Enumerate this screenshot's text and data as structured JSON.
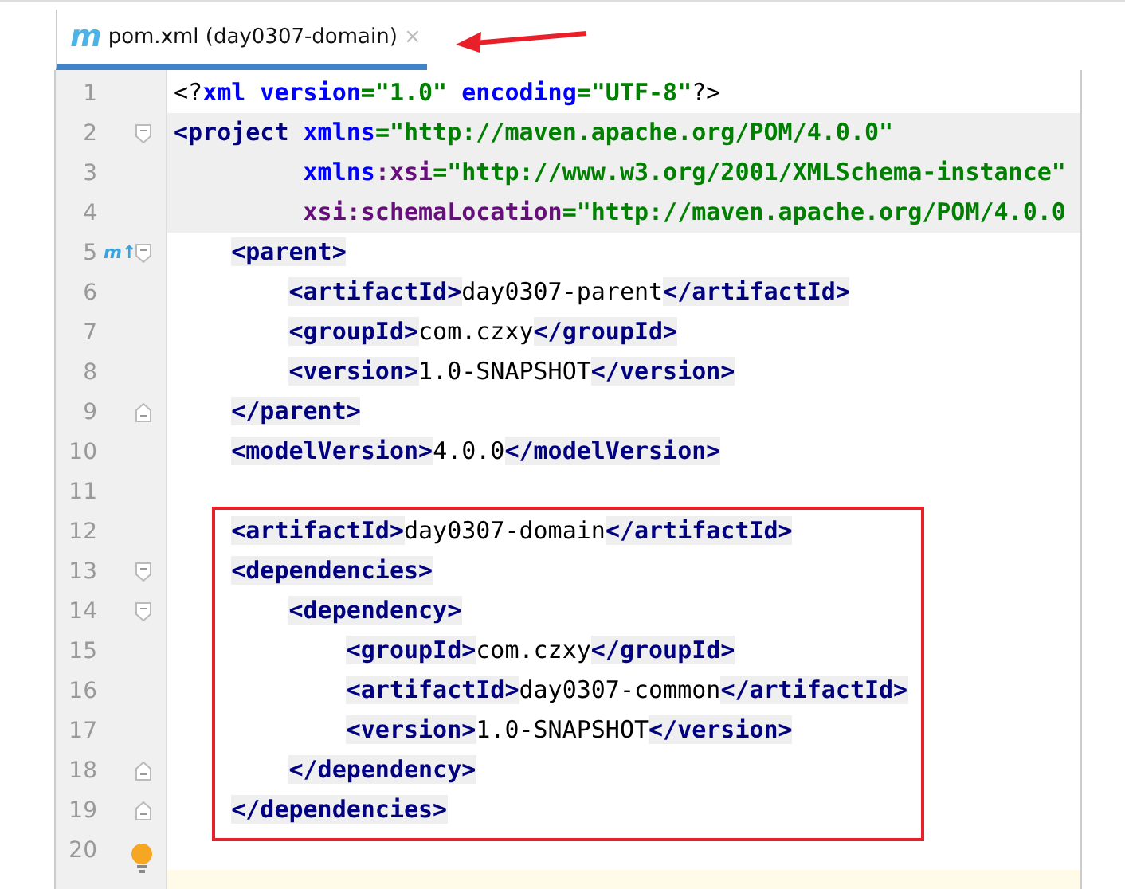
{
  "tab": {
    "icon_letter": "m",
    "title": "pom.xml (day0307-domain)",
    "close": "×",
    "selected": true
  },
  "lines": [
    {
      "number": "1",
      "tokens": [
        {
          "kind": "punct",
          "text": "<?"
        },
        {
          "kind": "attr",
          "text": "xml version"
        },
        {
          "kind": "value",
          "text": "=\"1.0\""
        },
        {
          "kind": "attr",
          "text": " encoding"
        },
        {
          "kind": "value",
          "text": "=\"UTF-8\""
        },
        {
          "kind": "punct",
          "text": "?>"
        }
      ]
    },
    {
      "number": "2",
      "highlighted": true,
      "fold_open": true,
      "tokens": [
        {
          "kind": "tag",
          "text": "<project"
        },
        {
          "kind": "attr",
          "text": " xmlns"
        },
        {
          "kind": "value",
          "text": "=\"http://maven.apache.org/POM/4.0.0\""
        }
      ]
    },
    {
      "number": "3",
      "highlighted": true,
      "tokens": [
        {
          "kind": "attr",
          "text": "         xmlns"
        },
        {
          "kind": "ns",
          "text": ":xsi"
        },
        {
          "kind": "value",
          "text": "=\"http://www.w3.org/2001/XMLSchema-instance\""
        }
      ]
    },
    {
      "number": "4",
      "highlighted": true,
      "tokens": [
        {
          "kind": "ns",
          "text": "         xsi:schemaLocation"
        },
        {
          "kind": "value",
          "text": "=\"http://maven.apache.org/POM/4.0.0"
        }
      ]
    },
    {
      "number": "5",
      "fold_open": true,
      "marker": "m↑",
      "tokens": [
        {
          "kind": "tag",
          "text": "    <parent>"
        }
      ]
    },
    {
      "number": "6",
      "tokens": [
        {
          "kind": "tag",
          "text": "        <artifactId>"
        },
        {
          "kind": "text",
          "text": "day0307-parent"
        },
        {
          "kind": "tag",
          "text": "</artifactId>"
        }
      ]
    },
    {
      "number": "7",
      "tokens": [
        {
          "kind": "tag",
          "text": "        <groupId>"
        },
        {
          "kind": "text",
          "text": "com.czxy"
        },
        {
          "kind": "tag",
          "text": "</groupId>"
        }
      ]
    },
    {
      "number": "8",
      "tokens": [
        {
          "kind": "tag",
          "text": "        <version>"
        },
        {
          "kind": "text",
          "text": "1.0-SNAPSHOT"
        },
        {
          "kind": "tag",
          "text": "</version>"
        }
      ]
    },
    {
      "number": "9",
      "fold_close": true,
      "tokens": [
        {
          "kind": "tag",
          "text": "    </parent>"
        }
      ]
    },
    {
      "number": "10",
      "tokens": [
        {
          "kind": "tag",
          "text": "    <modelVersion>"
        },
        {
          "kind": "text",
          "text": "4.0.0"
        },
        {
          "kind": "tag",
          "text": "</modelVersion>"
        }
      ]
    },
    {
      "number": "11"
    },
    {
      "number": "12",
      "tokens": [
        {
          "kind": "tag",
          "text": "    <artifactId>"
        },
        {
          "kind": "text",
          "text": "day0307-domain"
        },
        {
          "kind": "tag",
          "text": "</artifactId>"
        }
      ]
    },
    {
      "number": "13",
      "fold_open": true,
      "tokens": [
        {
          "kind": "tag",
          "text": "    <dependencies>"
        }
      ]
    },
    {
      "number": "14",
      "fold_open": true,
      "tokens": [
        {
          "kind": "tag",
          "text": "        <dependency>"
        }
      ]
    },
    {
      "number": "15",
      "tokens": [
        {
          "kind": "tag",
          "text": "            <groupId>"
        },
        {
          "kind": "text",
          "text": "com.czxy"
        },
        {
          "kind": "tag",
          "text": "</groupId>"
        }
      ]
    },
    {
      "number": "16",
      "tokens": [
        {
          "kind": "tag",
          "text": "            <artifactId>"
        },
        {
          "kind": "text",
          "text": "day0307-common"
        },
        {
          "kind": "tag",
          "text": "</artifactId>"
        }
      ]
    },
    {
      "number": "17",
      "tokens": [
        {
          "kind": "tag",
          "text": "            <version>"
        },
        {
          "kind": "text",
          "text": "1.0-SNAPSHOT"
        },
        {
          "kind": "tag",
          "text": "</version>"
        }
      ]
    },
    {
      "number": "18",
      "fold_close": true,
      "tokens": [
        {
          "kind": "tag",
          "text": "        </dependency>"
        }
      ]
    },
    {
      "number": "19",
      "fold_close": true,
      "tokens": [
        {
          "kind": "tag",
          "text": "    </dependencies>"
        }
      ]
    },
    {
      "number": "20",
      "bulb": true
    }
  ],
  "current_line": true
}
